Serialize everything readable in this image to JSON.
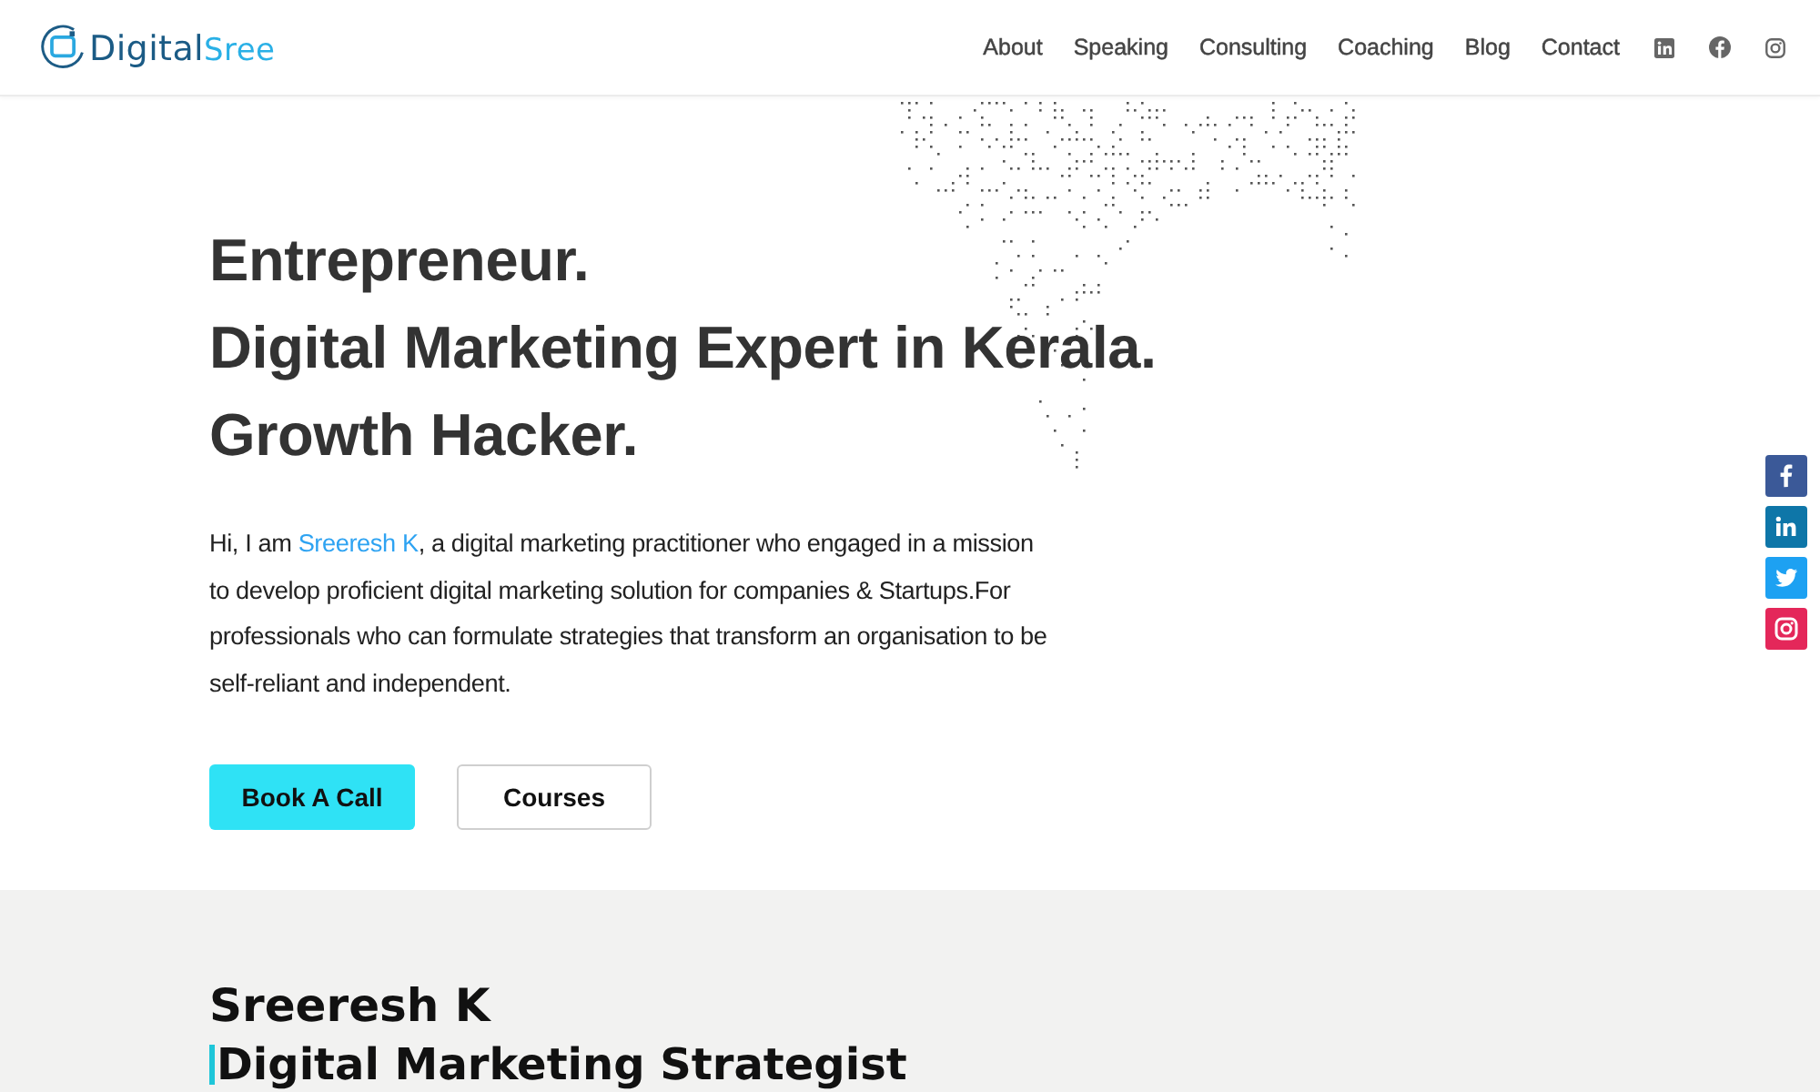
{
  "header": {
    "logo": {
      "word_1": "Digital",
      "word_2": "Sree"
    },
    "nav": [
      {
        "label": "About"
      },
      {
        "label": "Speaking"
      },
      {
        "label": "Consulting"
      },
      {
        "label": "Coaching"
      },
      {
        "label": "Blog"
      },
      {
        "label": "Contact"
      }
    ],
    "social_links": [
      {
        "kind": "linkedin"
      },
      {
        "kind": "facebook"
      },
      {
        "kind": "instagram"
      }
    ]
  },
  "hero": {
    "headlines": [
      "Entrepreneur.",
      "Digital Marketing Expert in Kerala.",
      "Growth Hacker."
    ],
    "intro": {
      "before": "Hi, I am ",
      "link": "Sreeresh K",
      "after": ", a digital marketing practitioner who engaged in a mission to develop proficient digital marketing solution for companies & Startups.For professionals who can formulate strategies that transform an organisation to be self-reliant and independent."
    },
    "buttons": [
      {
        "label": "Book A Call",
        "kind": "primary"
      },
      {
        "label": "Courses",
        "kind": "secondary"
      }
    ]
  },
  "share_bar": [
    {
      "kind": "facebook"
    },
    {
      "kind": "linkedin"
    },
    {
      "kind": "twitter"
    },
    {
      "kind": "instagram"
    }
  ],
  "about": {
    "name": "Sreeresh K",
    "role": "Digital Marketing Strategist"
  }
}
